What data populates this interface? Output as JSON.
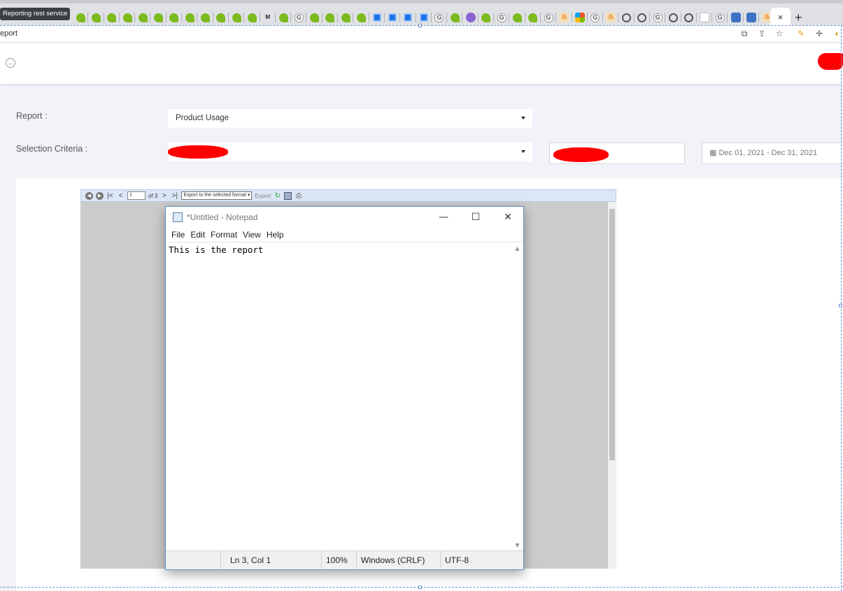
{
  "browser": {
    "tab_tooltip": "Reporting rest service",
    "tab_favicons": [
      "s",
      "s",
      "s",
      "s",
      "s",
      "s",
      "s",
      "s",
      "s",
      "s",
      "s",
      "s",
      "m",
      "s",
      "g",
      "s",
      "s",
      "s",
      "s",
      "b",
      "b",
      "b",
      "b",
      "g",
      "s",
      "p",
      "s",
      "g",
      "s",
      "s",
      "g",
      "j",
      "ms",
      "g",
      "j",
      "w",
      "w",
      "g",
      "w",
      "w",
      "e",
      "g",
      "v",
      "v",
      "j"
    ],
    "tab_favicon_text": {
      "m": "M",
      "g": "G",
      "j": "♨"
    },
    "active_tab_close": "×",
    "new_tab": "+",
    "url": "eport",
    "toolbar_icons": [
      "translate-icon",
      "share-icon",
      "bookmark-star-icon",
      "extension-icon",
      "move-icon",
      "profile-icon"
    ]
  },
  "header": {
    "back_icon": "←"
  },
  "form": {
    "report_label": "Report :",
    "report_value": "Product Usage",
    "selection_label": "Selection Criteria :",
    "selection_value": "",
    "client_value": "",
    "date_range": "Dec 01, 2021 - Dec 31, 2021",
    "date_icon": "▦"
  },
  "viewer": {
    "page_number": "1",
    "page_of": "of 3",
    "export_select": "Export to the selected format ▾",
    "export_label": "Export"
  },
  "notepad": {
    "title": "*Untitled - Notepad",
    "menu": [
      "File",
      "Edit",
      "Format",
      "View",
      "Help"
    ],
    "content": "This is the report",
    "status": {
      "position": "Ln 3, Col 1",
      "zoom": "100%",
      "line_endings": "Windows (CRLF)",
      "encoding": "UTF-8"
    },
    "minimize": "—",
    "maximize": "☐",
    "close": "✕"
  },
  "colors": {
    "redaction": "#ff0000",
    "page_bg": "#f1f3f8",
    "viewer_toolbar": "#dbe6f6"
  }
}
